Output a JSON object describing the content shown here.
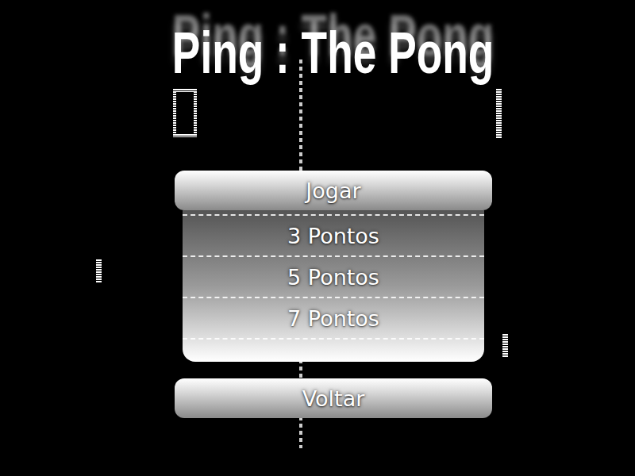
{
  "title": "Ping : The Pong",
  "play_button": {
    "label": "Jogar"
  },
  "options": [
    {
      "label": "3 Pontos"
    },
    {
      "label": "5 Pontos"
    },
    {
      "label": "7 Pontos"
    }
  ],
  "back_button": {
    "label": "Voltar"
  }
}
